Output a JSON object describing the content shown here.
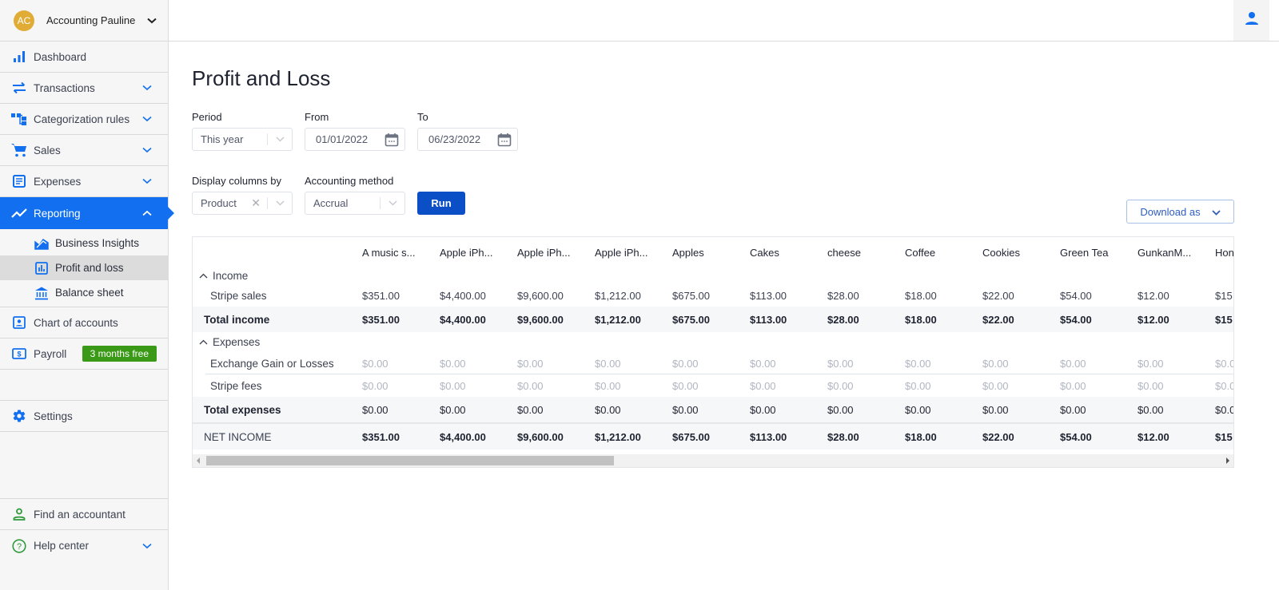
{
  "org": {
    "initials": "AC",
    "name": "Accounting Pauline"
  },
  "colors": {
    "accent": "#1270f0",
    "run_button": "#0b4fc7",
    "badge_green": "#3a9a18",
    "avatar": "#e0ac36",
    "help_green": "#2f9a3c"
  },
  "sidebar": {
    "items": [
      {
        "label": "Dashboard",
        "icon": "bar-chart-icon"
      },
      {
        "label": "Transactions",
        "icon": "swap-arrows-icon",
        "expandable": true
      },
      {
        "label": "Categorization rules",
        "icon": "hierarchy-icon",
        "expandable": true
      },
      {
        "label": "Sales",
        "icon": "cart-icon",
        "expandable": true
      },
      {
        "label": "Expenses",
        "icon": "document-icon",
        "expandable": true
      },
      {
        "label": "Reporting",
        "icon": "trend-line-icon",
        "expanded": true,
        "active": true
      },
      {
        "label": "Chart of accounts",
        "icon": "id-card-icon"
      },
      {
        "label": "Payroll",
        "icon": "dollar-bill-icon",
        "badge": "3 months free"
      },
      {
        "label": "Settings",
        "icon": "gear-icon"
      }
    ],
    "reporting_sub": [
      {
        "label": "Business Insights",
        "icon": "insights-icon"
      },
      {
        "label": "Profit and loss",
        "icon": "report-chart-icon",
        "selected": true
      },
      {
        "label": "Balance sheet",
        "icon": "bank-icon"
      }
    ],
    "bottom": [
      {
        "label": "Find an accountant",
        "icon": "person-icon"
      },
      {
        "label": "Help center",
        "icon": "help-circle-icon",
        "expandable": true
      }
    ]
  },
  "page": {
    "title": "Profit and Loss"
  },
  "filters": {
    "period": {
      "label": "Period",
      "value": "This year"
    },
    "from": {
      "label": "From",
      "value": "01/01/2022"
    },
    "to": {
      "label": "To",
      "value": "06/23/2022"
    },
    "display_columns": {
      "label": "Display columns by",
      "value": "Product"
    },
    "accounting_method": {
      "label": "Accounting method",
      "value": "Accrual"
    },
    "run_label": "Run",
    "download_label": "Download as"
  },
  "table": {
    "columns": [
      "A music s...",
      "Apple iPh...",
      "Apple iPh...",
      "Apple iPh...",
      "Apples",
      "Cakes",
      "cheese",
      "Coffee",
      "Cookies",
      "Green Tea",
      "GunkanM...",
      "Hon"
    ],
    "income_label": "Income",
    "income_rows": [
      {
        "name": "Stripe sales",
        "values": [
          "$351.00",
          "$4,400.00",
          "$9,600.00",
          "$1,212.00",
          "$675.00",
          "$113.00",
          "$28.00",
          "$18.00",
          "$22.00",
          "$54.00",
          "$12.00",
          "$15"
        ]
      }
    ],
    "total_income": {
      "name": "Total income",
      "values": [
        "$351.00",
        "$4,400.00",
        "$9,600.00",
        "$1,212.00",
        "$675.00",
        "$113.00",
        "$28.00",
        "$18.00",
        "$22.00",
        "$54.00",
        "$12.00",
        "$15"
      ]
    },
    "expenses_label": "Expenses",
    "expense_rows": [
      {
        "name": "Exchange Gain or Losses",
        "values": [
          "$0.00",
          "$0.00",
          "$0.00",
          "$0.00",
          "$0.00",
          "$0.00",
          "$0.00",
          "$0.00",
          "$0.00",
          "$0.00",
          "$0.00",
          "$0.0"
        ]
      },
      {
        "name": "Stripe fees",
        "values": [
          "$0.00",
          "$0.00",
          "$0.00",
          "$0.00",
          "$0.00",
          "$0.00",
          "$0.00",
          "$0.00",
          "$0.00",
          "$0.00",
          "$0.00",
          "$0.0"
        ]
      }
    ],
    "total_expenses": {
      "name": "Total expenses",
      "values": [
        "$0.00",
        "$0.00",
        "$0.00",
        "$0.00",
        "$0.00",
        "$0.00",
        "$0.00",
        "$0.00",
        "$0.00",
        "$0.00",
        "$0.00",
        "$0.0"
      ]
    },
    "net_income": {
      "name": "NET INCOME",
      "values": [
        "$351.00",
        "$4,400.00",
        "$9,600.00",
        "$1,212.00",
        "$675.00",
        "$113.00",
        "$28.00",
        "$18.00",
        "$22.00",
        "$54.00",
        "$12.00",
        "$15"
      ]
    }
  }
}
